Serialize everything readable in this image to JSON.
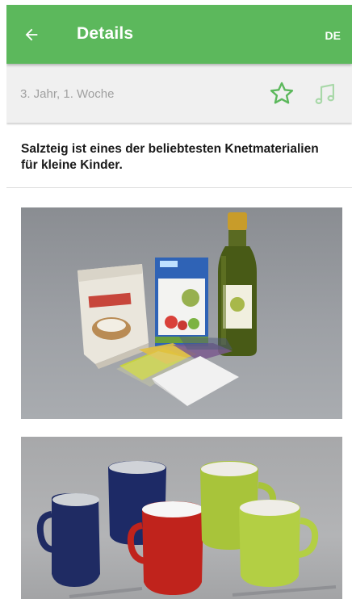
{
  "header": {
    "title": "Details",
    "language": "DE",
    "back_icon": "arrow-left-icon",
    "bg_color": "#5cb85c"
  },
  "subheader": {
    "week_label": "3. Jahr, 1. Woche",
    "favorite_icon": "star-outline-icon",
    "music_icon": "music-note-icon",
    "icon_color": "#5cb85c"
  },
  "intro": {
    "text": "Salzteig ist eines der beliebtesten Knetmaterialien für kleine Kinder."
  },
  "images": [
    {
      "name": "ingredients-photo",
      "subject": "flour, salt, oil, paper"
    },
    {
      "name": "mugs-photo",
      "subject": "colored mugs with water, salt, flour"
    }
  ]
}
